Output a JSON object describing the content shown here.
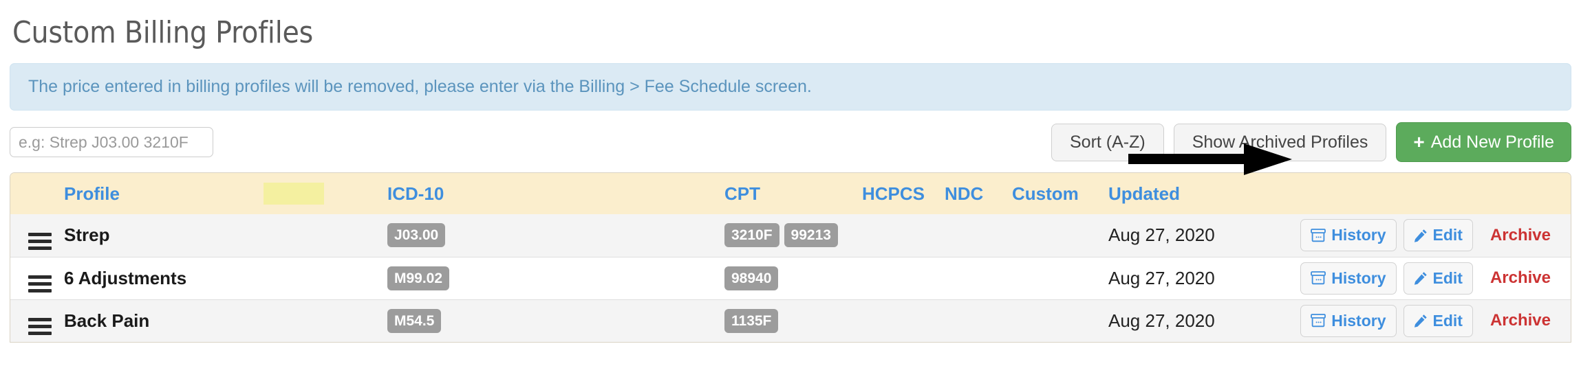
{
  "page": {
    "title": "Custom Billing Profiles"
  },
  "alert": {
    "message": "The price entered in billing profiles will be removed, please enter via the Billing > Fee Schedule screen."
  },
  "toolbar": {
    "search_placeholder": "e.g: Strep J03.00 3210F",
    "search_value": "",
    "sort_label": "Sort (A-Z)",
    "show_archived_label": "Show Archived Profiles",
    "add_new_label": "Add New Profile",
    "add_new_plus": "+"
  },
  "annotation": {
    "type": "arrow",
    "points_to": "add-new-profile-button",
    "color": "#000000"
  },
  "table": {
    "headers": {
      "profile": "Profile",
      "highlight": "",
      "icd10": "ICD-10",
      "cpt": "CPT",
      "hcpcs": "HCPCS",
      "ndc": "NDC",
      "custom": "Custom",
      "updated": "Updated"
    },
    "row_actions": {
      "history": "History",
      "edit": "Edit",
      "archive": "Archive"
    },
    "rows": [
      {
        "profile": "Strep",
        "icd10": [
          "J03.00"
        ],
        "cpt": [
          "3210F",
          "99213"
        ],
        "hcpcs": [],
        "ndc": [],
        "custom": [],
        "updated": "Aug 27, 2020"
      },
      {
        "profile": "6 Adjustments",
        "icd10": [
          "M99.02"
        ],
        "cpt": [
          "98940"
        ],
        "hcpcs": [],
        "ndc": [],
        "custom": [],
        "updated": "Aug 27, 2020"
      },
      {
        "profile": "Back Pain",
        "icd10": [
          "M54.5"
        ],
        "cpt": [
          "1135F"
        ],
        "hcpcs": [],
        "ndc": [],
        "custom": [],
        "updated": "Aug 27, 2020"
      }
    ]
  },
  "colors": {
    "accent_blue": "#3e8ede",
    "success_green": "#5cab5c",
    "danger_red": "#cc3333",
    "header_cream": "#fbeecd",
    "highlight_yellow": "#f4f0a0",
    "badge_gray": "#9c9c9c",
    "alert_bg": "#dbeaf4",
    "alert_text": "#5b94bd"
  }
}
